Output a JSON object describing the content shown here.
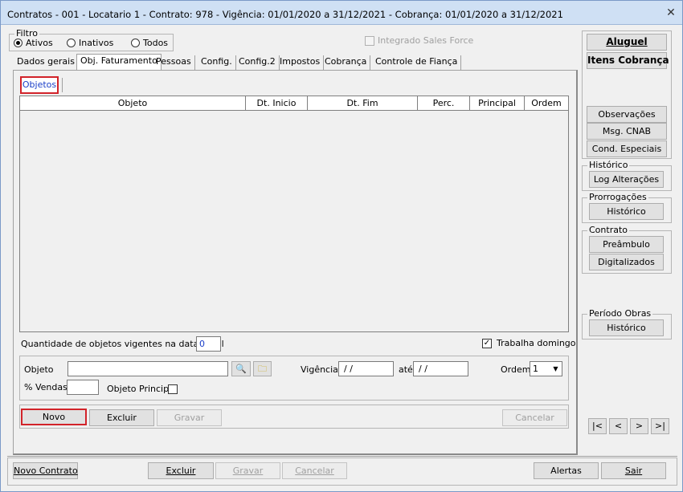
{
  "window": {
    "title": "Contratos - 001 - Locatario 1 - Contrato: 978 - Vigência: 01/01/2020 a 31/12/2021 - Cobrança: 01/01/2020 a 31/12/2021"
  },
  "filter": {
    "title": "Filtro",
    "options": [
      "Ativos",
      "Inativos",
      "Todos"
    ],
    "selected": "Ativos"
  },
  "integrated": {
    "label": "Integrado Sales Force"
  },
  "tabs": [
    "Dados gerais",
    "Obj. Faturamento",
    "Pessoas",
    "Config.",
    "Config.2",
    "Impostos",
    "Cobrança",
    "Controle de Fiança"
  ],
  "active_tab": "Obj. Faturamento",
  "subtab": "Objetos",
  "grid": {
    "columns": [
      "Objeto",
      "Dt. Inicio",
      "Dt. Fim",
      "Perc.",
      "Principal",
      "Ordem"
    ],
    "rows": []
  },
  "qty": {
    "label": "Quantidade de objetos vigentes na data atual",
    "value": "0"
  },
  "trabalha": {
    "label": "Trabalha domingo",
    "checked": true
  },
  "form": {
    "objeto_label": "Objeto",
    "vigencia_label": "Vigência",
    "vigencia_from": "/ /",
    "ate_label": "até",
    "vigencia_to": "/ /",
    "ordem_label": "Ordem",
    "ordem_value": "1",
    "vendas_label": "% Vendas",
    "principal_label": "Objeto Principal"
  },
  "panel_buttons": {
    "novo": "Novo",
    "excluir": "Excluir",
    "gravar": "Gravar",
    "cancelar": "Cancelar"
  },
  "right": {
    "aluguel": "Aluguel",
    "itens": "Itens Cobrança",
    "observacoes": "Observações",
    "msg_cnab": "Msg. CNAB",
    "cond": "Cond. Especiais",
    "historico_title": "Histórico",
    "log": "Log Alterações",
    "prorrogacoes_title": "Prorrogações",
    "prorrogacoes_btn": "Histórico",
    "contrato_title": "Contrato",
    "preambulo": "Preâmbulo",
    "digitalizados": "Digitalizados",
    "obras_title": "Período Obras",
    "obras_btn": "Histórico"
  },
  "nav": {
    "first": "|<",
    "prev": "<",
    "next": ">",
    "last": ">|"
  },
  "footer": {
    "novo_contrato": "Novo Contrato",
    "excluir": "Excluir",
    "gravar": "Gravar",
    "cancelar": "Cancelar",
    "alertas": "Alertas",
    "sair": "Sair"
  }
}
